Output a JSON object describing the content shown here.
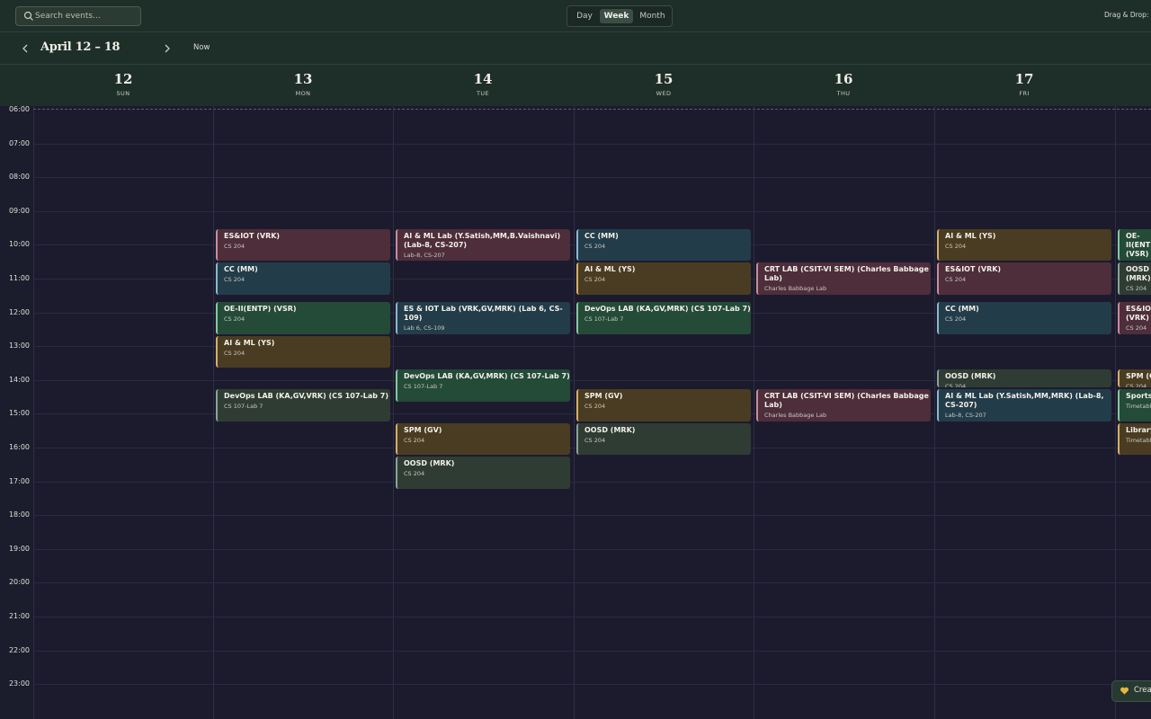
{
  "search": {
    "placeholder": "Search events..."
  },
  "views": {
    "day": "Day",
    "week": "Week",
    "month": "Month",
    "active": "week"
  },
  "drag_drop_label": "Drag & Drop: O",
  "nav": {
    "range_title": "April 12 – 18",
    "now_label": "Now"
  },
  "days": [
    {
      "num": "12",
      "name": "SUN"
    },
    {
      "num": "13",
      "name": "MON"
    },
    {
      "num": "14",
      "name": "TUE"
    },
    {
      "num": "15",
      "name": "WED"
    },
    {
      "num": "16",
      "name": "THU"
    },
    {
      "num": "17",
      "name": "FRI"
    }
  ],
  "hours": [
    "06:00",
    "07:00",
    "08:00",
    "09:00",
    "10:00",
    "11:00",
    "12:00",
    "13:00",
    "14:00",
    "15:00",
    "16:00",
    "17:00",
    "18:00",
    "19:00",
    "20:00",
    "21:00",
    "22:00",
    "23:00"
  ],
  "events": {
    "mon": [
      {
        "title": "ES&IOT (VRK)",
        "location": "CS 204",
        "start": "09:30",
        "end": "10:30",
        "color": "pink"
      },
      {
        "title": "CC (MM)",
        "location": "CS 204",
        "start": "10:30",
        "end": "11:30",
        "color": "blue"
      },
      {
        "title": "OE-II(ENTP) (VSR)",
        "location": "CS 204",
        "start": "11:40",
        "end": "12:40",
        "color": "green"
      },
      {
        "title": "AI & ML (YS)",
        "location": "CS 204",
        "start": "12:40",
        "end": "13:40",
        "color": "amber"
      },
      {
        "title": "DevOps LAB (KA,GV,VRK) (CS 107-Lab 7)",
        "location": "CS 107-Lab 7",
        "start": "14:15",
        "end": "15:15",
        "color": "gray"
      }
    ],
    "tue": [
      {
        "title": "AI & ML Lab (Y.Satish,MM,B.Vaishnavi) (Lab-8, CS-207)",
        "location": "Lab-8, CS-207",
        "start": "09:30",
        "end": "10:30",
        "color": "pink"
      },
      {
        "title": "ES & IOT Lab (VRK,GV,MRK) (Lab 6, CS-109)",
        "location": "Lab 6, CS-109",
        "start": "11:40",
        "end": "12:40",
        "color": "blue"
      },
      {
        "title": "DevOps LAB (KA,GV,MRK) (CS 107-Lab 7)",
        "location": "CS 107-Lab 7",
        "start": "13:40",
        "end": "14:40",
        "color": "green"
      },
      {
        "title": "SPM (GV)",
        "location": "CS 204",
        "start": "15:15",
        "end": "16:15",
        "color": "amber"
      },
      {
        "title": "OOSD (MRK)",
        "location": "CS 204",
        "start": "16:15",
        "end": "17:15",
        "color": "gray"
      }
    ],
    "wed": [
      {
        "title": "CC (MM)",
        "location": "CS 204",
        "start": "09:30",
        "end": "10:30",
        "color": "blue"
      },
      {
        "title": "AI & ML (YS)",
        "location": "CS 204",
        "start": "10:30",
        "end": "11:30",
        "color": "amber"
      },
      {
        "title": "DevOps LAB (KA,GV,MRK) (CS 107-Lab 7)",
        "location": "CS 107-Lab 7",
        "start": "11:40",
        "end": "12:40",
        "color": "green"
      },
      {
        "title": "SPM (GV)",
        "location": "CS 204",
        "start": "14:15",
        "end": "15:15",
        "color": "amber"
      },
      {
        "title": "OOSD (MRK)",
        "location": "CS 204",
        "start": "15:15",
        "end": "16:15",
        "color": "gray"
      }
    ],
    "thu": [
      {
        "title": "CRT LAB (CSIT-VI SEM) (Charles Babbage Lab)",
        "location": "Charles Babbage Lab",
        "start": "10:30",
        "end": "11:30",
        "color": "pink"
      },
      {
        "title": "CRT LAB (CSIT-VI SEM) (Charles Babbage Lab)",
        "location": "Charles Babbage Lab",
        "start": "14:15",
        "end": "15:15",
        "color": "pink"
      }
    ],
    "fri": [
      {
        "title": "AI & ML (YS)",
        "location": "CS 204",
        "start": "09:30",
        "end": "10:30",
        "color": "amber"
      },
      {
        "title": "ES&IOT (VRK)",
        "location": "CS 204",
        "start": "10:30",
        "end": "11:30",
        "color": "pink"
      },
      {
        "title": "CC (MM)",
        "location": "CS 204",
        "start": "11:40",
        "end": "12:40",
        "color": "blue"
      },
      {
        "title": "OOSD (MRK)",
        "location": "CS 204",
        "start": "13:40",
        "end": "14:15",
        "color": "gray"
      },
      {
        "title": "AI & ML Lab (Y.Satish,MM,MRK) (Lab-8, CS-207)",
        "location": "Lab-8, CS-207",
        "start": "14:15",
        "end": "15:15",
        "color": "blue"
      }
    ],
    "sat": [
      {
        "title": "OE-II(ENTP) (VSR)",
        "location": "CS 204",
        "start": "09:30",
        "end": "10:30",
        "color": "green"
      },
      {
        "title": "OOSD (MRK)",
        "location": "CS 204",
        "start": "10:30",
        "end": "11:30",
        "color": "gray"
      },
      {
        "title": "ES&IOT (VRK)",
        "location": "CS 204",
        "start": "11:40",
        "end": "12:40",
        "color": "pink"
      },
      {
        "title": "SPM (GV)",
        "location": "CS 204",
        "start": "13:40",
        "end": "14:15",
        "color": "amber"
      },
      {
        "title": "Sports",
        "location": "Timetable",
        "start": "14:15",
        "end": "15:15",
        "color": "green"
      },
      {
        "title": "Library",
        "location": "Timetable",
        "start": "15:15",
        "end": "16:15",
        "color": "amber"
      }
    ]
  },
  "create_button": {
    "label": "Create"
  },
  "colors": {
    "accent": "#3a4e45",
    "background": "#1c1b2e",
    "header": "#1e2e29"
  }
}
